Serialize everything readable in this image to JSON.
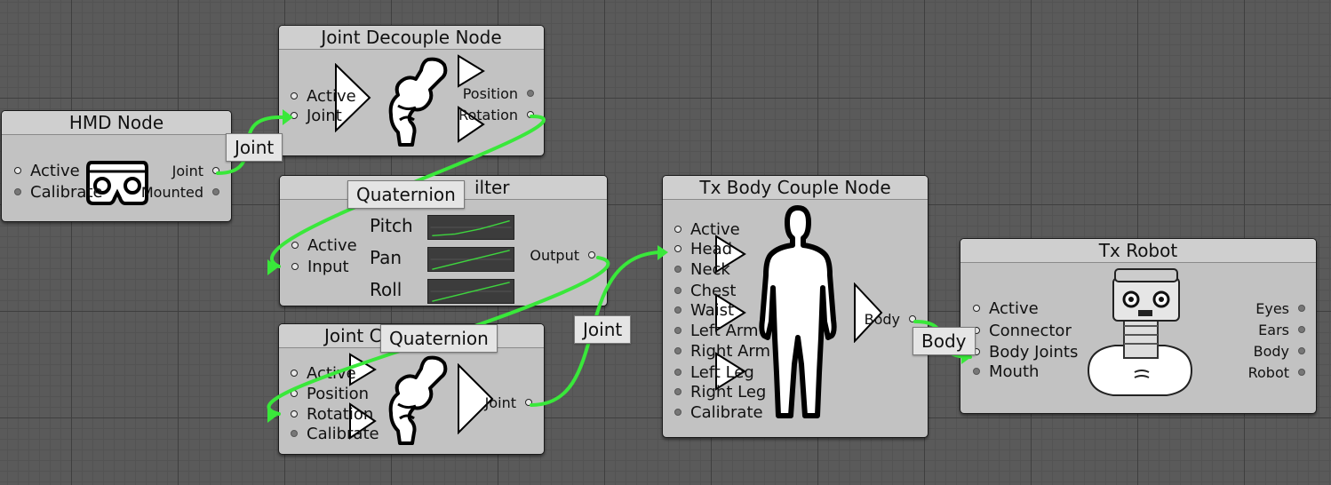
{
  "hmd_node": {
    "title": "HMD Node",
    "inputs": [
      "Active",
      "Calibrate"
    ],
    "outputs": [
      "Joint",
      "Mounted"
    ]
  },
  "decouple_node": {
    "title": "Joint Decouple Node",
    "inputs": [
      "Active",
      "Joint"
    ],
    "outputs": [
      "Position",
      "Rotation"
    ]
  },
  "filter_node": {
    "title": "ilter",
    "inputs": [
      "Active",
      "Input"
    ],
    "outputs": [
      "Output"
    ],
    "channels": [
      "Pitch",
      "Pan",
      "Roll"
    ]
  },
  "joint_couple_node": {
    "title": "Joint C",
    "inputs": [
      "Active",
      "Position",
      "Rotation",
      "Calibrate"
    ],
    "outputs": [
      "Joint"
    ]
  },
  "body_couple_node": {
    "title": "Tx Body Couple Node",
    "inputs": [
      "Active",
      "Head",
      "Neck",
      "Chest",
      "Waist",
      "Left Arm",
      "Right Arm",
      "Left Leg",
      "Right Leg",
      "Calibrate"
    ],
    "outputs": [
      "Body"
    ]
  },
  "robot_node": {
    "title": "Tx Robot",
    "inputs": [
      "Active",
      "Connector",
      "Body Joints",
      "Mouth"
    ],
    "outputs": [
      "Eyes",
      "Ears",
      "Body",
      "Robot"
    ]
  },
  "connection_labels": {
    "hmd_to_decouple": "Joint",
    "decouple_to_filter": "Quaternion",
    "filter_to_couple": "Quaternion",
    "couple_to_body": "Joint",
    "body_to_robot": "Body"
  },
  "colors": {
    "wire": "#39e83a",
    "node_bg": "#c2c2c2",
    "canvas_bg": "#5a5a5a"
  }
}
